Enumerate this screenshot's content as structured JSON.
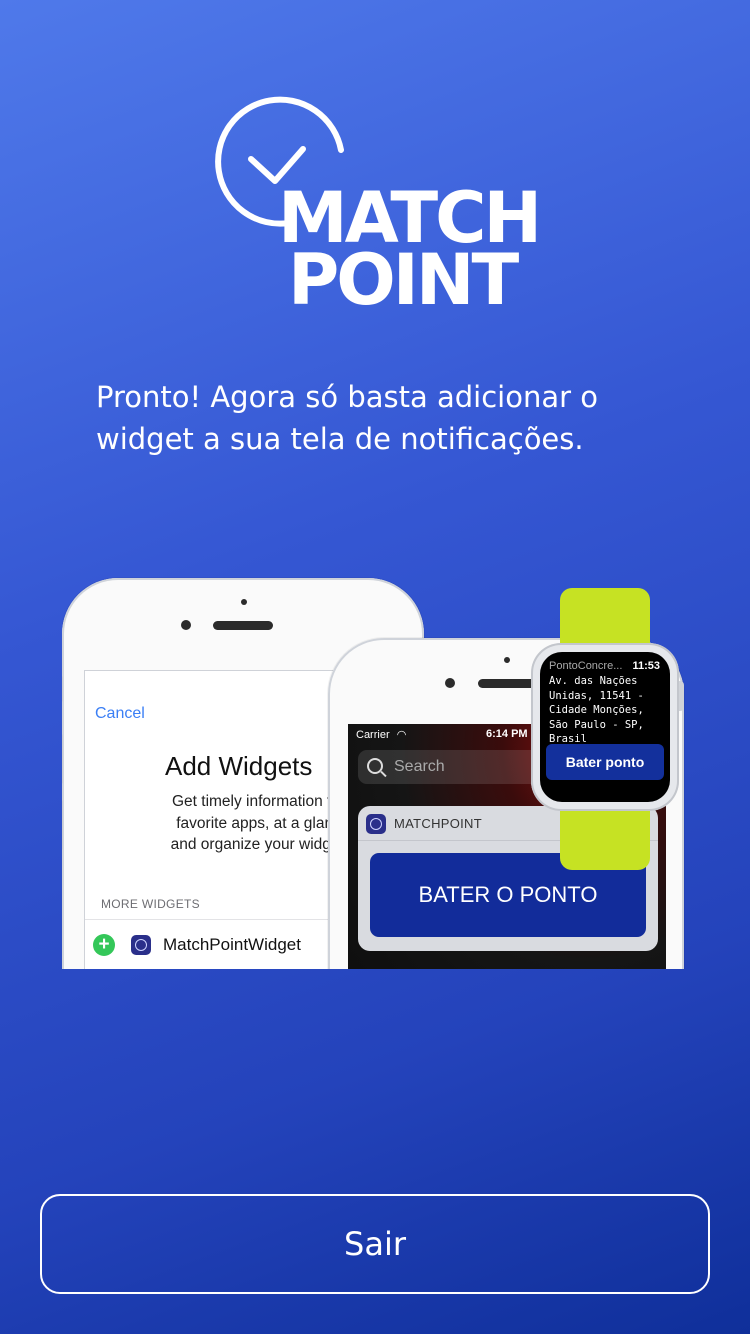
{
  "logo": {
    "line1": "MATCH",
    "line2": "POINT"
  },
  "message": "Pronto! Agora só basta adicionar o widget a sua tela de notificações.",
  "illustration": {
    "left_phone": {
      "cancel_label": "Cancel",
      "title": "Add Widgets",
      "description_lines": [
        "Get timely information from",
        "favorite apps, at a glance.",
        "and organize your widgets l"
      ],
      "section_header": "MORE WIDGETS",
      "widget_name": "MatchPointWidget"
    },
    "right_phone": {
      "carrier": "Carrier",
      "time": "6:14 PM",
      "search_placeholder": "Search",
      "notification_app": "MATCHPOINT",
      "action_label": "BATER O PONTO"
    },
    "watch": {
      "app_name": "PontoConcre...",
      "time": "11:53",
      "address": "Av. das Nações Unidas, 11541 - Cidade Monções, São Paulo - SP, Brasil",
      "action_label": "Bater ponto"
    }
  },
  "exit_button": {
    "label": "Sair"
  },
  "colors": {
    "background_start": "#4f79ea",
    "background_end": "#0f2f9a",
    "widget_button": "#122c9a",
    "watch_strap": "#c6e223",
    "ios_blue": "#3b7ff5"
  }
}
